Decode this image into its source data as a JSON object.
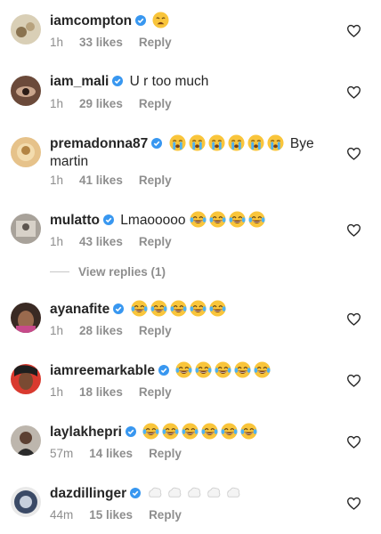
{
  "comments": [
    {
      "username": "iamcompton",
      "text": "",
      "emoji": [
        {
          "kind": "weary",
          "count": 1
        }
      ],
      "time": "1h",
      "likes": "33 likes",
      "reply": "Reply"
    },
    {
      "username": "iam_mali",
      "text": "U r too much",
      "emoji": [],
      "time": "1h",
      "likes": "29 likes",
      "reply": "Reply"
    },
    {
      "username": "premadonna87",
      "text": "Bye martin",
      "emoji": [
        {
          "kind": "loudly-crying",
          "count": 6
        }
      ],
      "time": "1h",
      "likes": "41 likes",
      "reply": "Reply"
    },
    {
      "username": "mulatto",
      "text": "Lmaooooo",
      "emoji": [
        {
          "kind": "tears-of-joy",
          "count": 4
        }
      ],
      "time": "1h",
      "likes": "43 likes",
      "reply": "Reply"
    },
    {
      "username": "ayanafite",
      "text": "",
      "emoji": [
        {
          "kind": "tears-of-joy",
          "count": 5
        }
      ],
      "time": "1h",
      "likes": "28 likes",
      "reply": "Reply"
    },
    {
      "username": "iamreemarkable",
      "text": "",
      "emoji": [
        {
          "kind": "tears-of-joy",
          "count": 5
        }
      ],
      "time": "1h",
      "likes": "18 likes",
      "reply": "Reply"
    },
    {
      "username": "laylakhepri",
      "text": "",
      "emoji": [
        {
          "kind": "tears-of-joy",
          "count": 6
        }
      ],
      "time": "57m",
      "likes": "14 likes",
      "reply": "Reply"
    },
    {
      "username": "dazdillinger",
      "text": "",
      "emoji": [
        {
          "kind": "dashing-away",
          "count": 5
        }
      ],
      "time": "44m",
      "likes": "15 likes",
      "reply": "Reply"
    }
  ],
  "view_replies": "View replies (1)",
  "colors": {
    "verified": "#3897f0",
    "meta": "#8e8e8e",
    "text": "#262626"
  }
}
